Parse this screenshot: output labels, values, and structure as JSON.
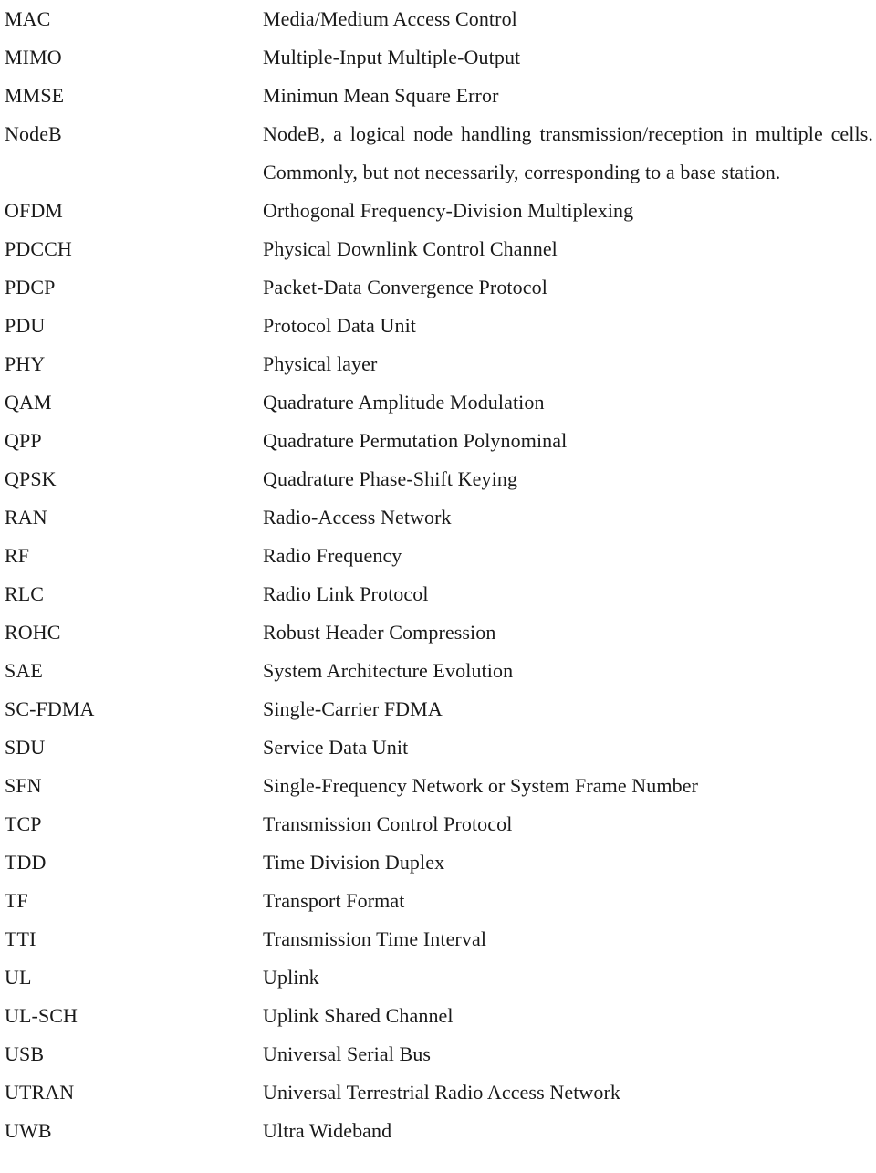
{
  "document": {
    "type": "glossary-list",
    "column_headers_visible": false,
    "entries": [
      {
        "term": "MAC",
        "definition": "Media/Medium Access Control",
        "multiline": false
      },
      {
        "term": "MIMO",
        "definition": "Multiple-Input Multiple-Output",
        "multiline": false
      },
      {
        "term": "MMSE",
        "definition": "Minimun Mean Square Error",
        "multiline": false
      },
      {
        "term": "NodeB",
        "definition": "NodeB, a logical node handling transmission/reception in multiple cells. Commonly, but not necessarily, corresponding to a base station.",
        "multiline": true
      },
      {
        "term": "OFDM",
        "definition": "Orthogonal Frequency-Division Multiplexing",
        "multiline": false
      },
      {
        "term": "PDCCH",
        "definition": "Physical Downlink Control Channel",
        "multiline": false
      },
      {
        "term": "PDCP",
        "definition": "Packet-Data Convergence Protocol",
        "multiline": false
      },
      {
        "term": "PDU",
        "definition": "Protocol Data Unit",
        "multiline": false
      },
      {
        "term": "PHY",
        "definition": "Physical layer",
        "multiline": false
      },
      {
        "term": "QAM",
        "definition": "Quadrature Amplitude Modulation",
        "multiline": false
      },
      {
        "term": "QPP",
        "definition": "Quadrature Permutation Polynominal",
        "multiline": false
      },
      {
        "term": "QPSK",
        "definition": "Quadrature Phase-Shift Keying",
        "multiline": false
      },
      {
        "term": "RAN",
        "definition": "Radio-Access Network",
        "multiline": false
      },
      {
        "term": "RF",
        "definition": "Radio Frequency",
        "multiline": false
      },
      {
        "term": "RLC",
        "definition": "Radio Link Protocol",
        "multiline": false
      },
      {
        "term": "ROHC",
        "definition": "Robust Header Compression",
        "multiline": false
      },
      {
        "term": "SAE",
        "definition": "System Architecture Evolution",
        "multiline": false
      },
      {
        "term": "SC-FDMA",
        "definition": "Single-Carrier FDMA",
        "multiline": false
      },
      {
        "term": "SDU",
        "definition": "Service Data Unit",
        "multiline": false
      },
      {
        "term": "SFN",
        "definition": "Single-Frequency Network or System Frame Number",
        "multiline": false
      },
      {
        "term": "TCP",
        "definition": "Transmission Control Protocol",
        "multiline": false
      },
      {
        "term": "TDD",
        "definition": "Time Division Duplex",
        "multiline": false
      },
      {
        "term": "TF",
        "definition": "Transport Format",
        "multiline": false
      },
      {
        "term": "TTI",
        "definition": "Transmission Time Interval",
        "multiline": false
      },
      {
        "term": "UL",
        "definition": "Uplink",
        "multiline": false
      },
      {
        "term": "UL-SCH",
        "definition": "Uplink Shared Channel",
        "multiline": false
      },
      {
        "term": "USB",
        "definition": "Universal Serial Bus",
        "multiline": false
      },
      {
        "term": "UTRAN",
        "definition": "Universal Terrestrial Radio Access Network",
        "multiline": false
      },
      {
        "term": "UWB",
        "definition": "Ultra Wideband",
        "multiline": false
      }
    ]
  },
  "style": {
    "text_color": "#1a1a1a",
    "background_color": "#ffffff"
  }
}
